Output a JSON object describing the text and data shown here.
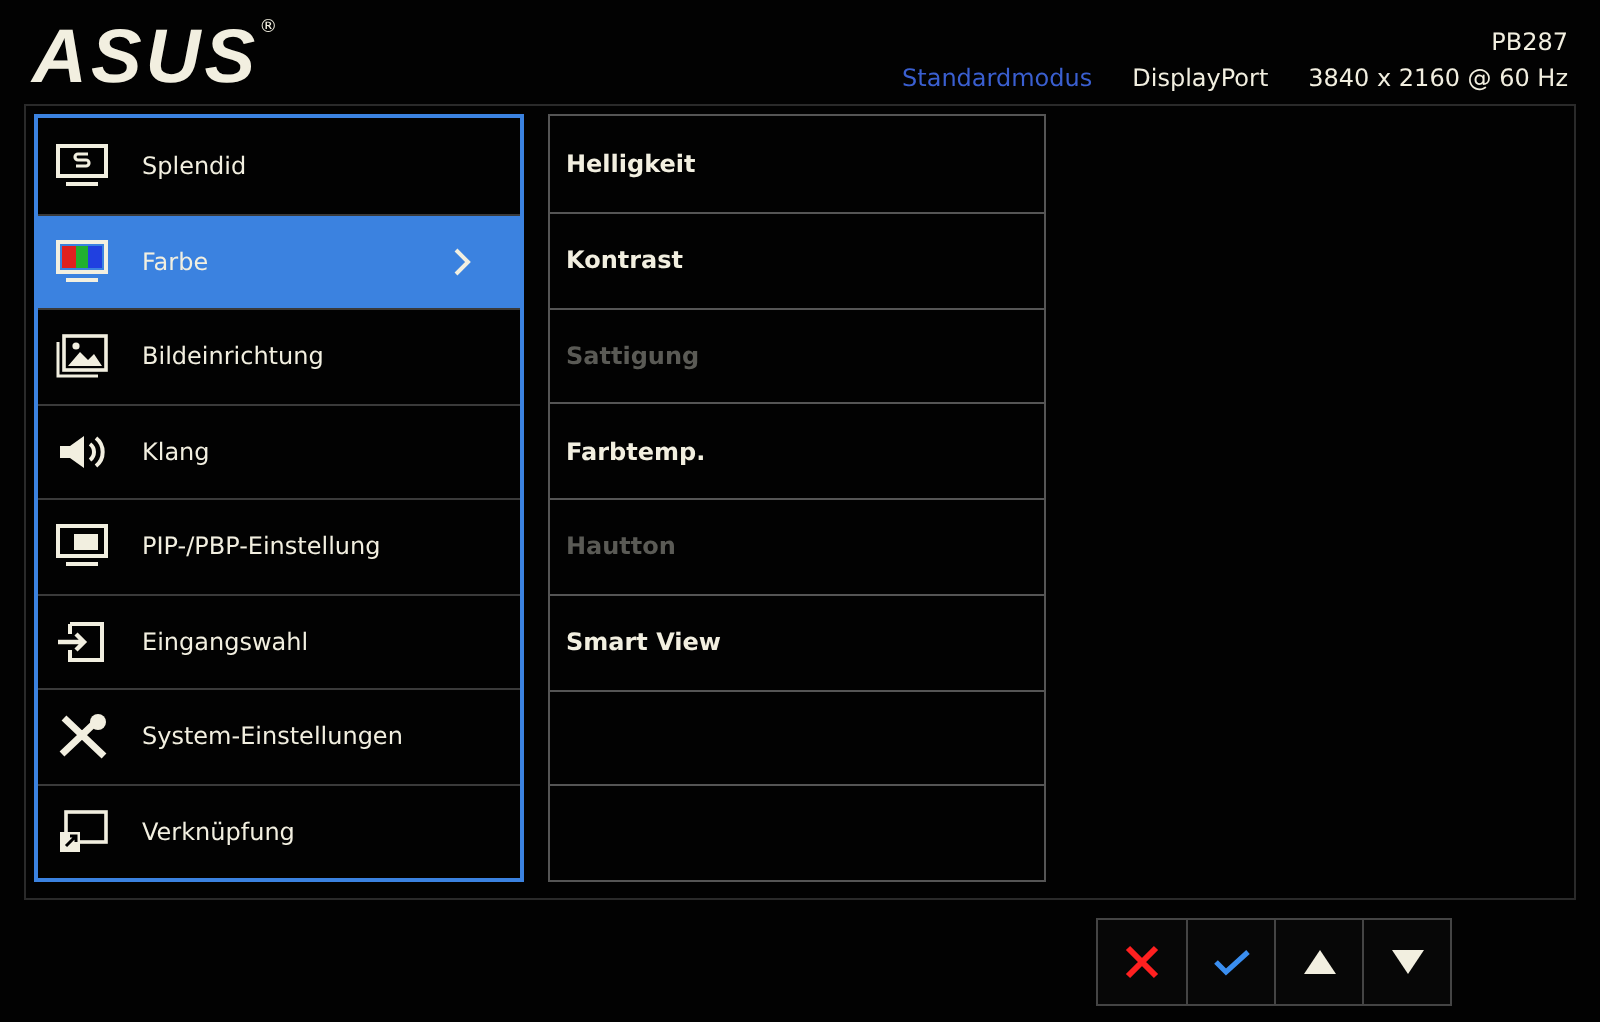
{
  "header": {
    "logo": "ASUS",
    "logo_mark": "®",
    "model": "PB287",
    "mode": "Standardmodus",
    "input": "DisplayPort",
    "resolution": "3840 x 2160 @ 60 Hz"
  },
  "menu": [
    {
      "label": "Splendid",
      "kind": "splendid",
      "selected": false
    },
    {
      "label": "Farbe",
      "kind": "color",
      "selected": true
    },
    {
      "label": "Bildeinrichtung",
      "kind": "image",
      "selected": false
    },
    {
      "label": "Klang",
      "kind": "sound",
      "selected": false
    },
    {
      "label": "PIP-/PBP-Einstellung",
      "kind": "pip",
      "selected": false
    },
    {
      "label": "Eingangswahl",
      "kind": "input",
      "selected": false
    },
    {
      "label": "System-Einstellungen",
      "kind": "system",
      "selected": false
    },
    {
      "label": "Verknüpfung",
      "kind": "shortcut",
      "selected": false
    }
  ],
  "submenu": [
    {
      "label": "Helligkeit",
      "disabled": false
    },
    {
      "label": "Kontrast",
      "disabled": false
    },
    {
      "label": "Sattigung",
      "disabled": true
    },
    {
      "label": "Farbtemp.",
      "disabled": false
    },
    {
      "label": "Hautton",
      "disabled": true
    },
    {
      "label": "Smart View",
      "disabled": false
    }
  ],
  "buttons": [
    {
      "kind": "close"
    },
    {
      "kind": "confirm"
    },
    {
      "kind": "up"
    },
    {
      "kind": "down"
    }
  ]
}
